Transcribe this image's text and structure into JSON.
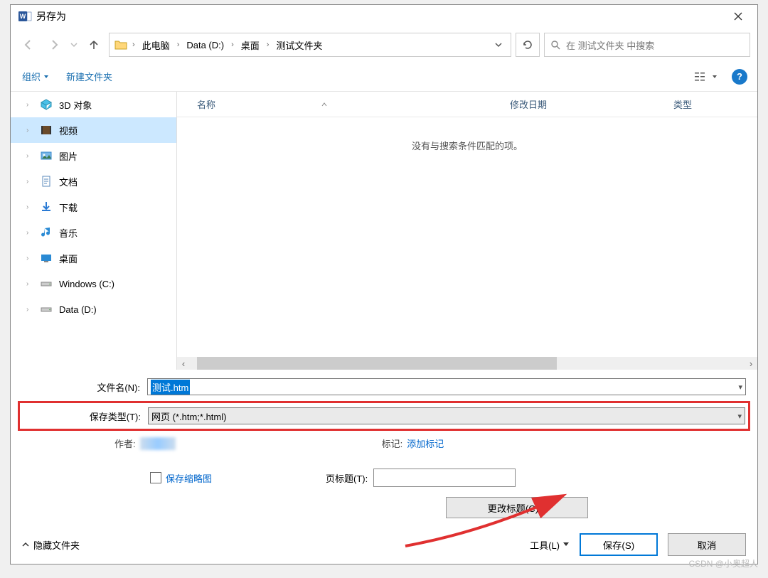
{
  "title": "另存为",
  "breadcrumb": [
    "此电脑",
    "Data (D:)",
    "桌面",
    "测试文件夹"
  ],
  "search_placeholder": "在 测试文件夹 中搜索",
  "toolbar": {
    "organize": "组织",
    "new_folder": "新建文件夹"
  },
  "sidebar_items": [
    {
      "label": "3D 对象",
      "icon": "cube",
      "color": "#2aa4d4"
    },
    {
      "label": "视频",
      "icon": "film",
      "color": "#8a5a2a",
      "selected": true
    },
    {
      "label": "图片",
      "icon": "image",
      "color": "#3a8acc"
    },
    {
      "label": "文档",
      "icon": "doc",
      "color": "#5a88bb"
    },
    {
      "label": "下载",
      "icon": "download",
      "color": "#2a7ad4"
    },
    {
      "label": "音乐",
      "icon": "music",
      "color": "#2a8ad4"
    },
    {
      "label": "桌面",
      "icon": "desktop",
      "color": "#2a8ad4"
    },
    {
      "label": "Windows (C:)",
      "icon": "drive",
      "color": "#888"
    },
    {
      "label": "Data (D:)",
      "icon": "drive",
      "color": "#888"
    }
  ],
  "columns": {
    "name": "名称",
    "date": "修改日期",
    "type": "类型"
  },
  "empty_message": "没有与搜索条件匹配的项。",
  "filename_label": "文件名(N):",
  "filename_value": "测试.htm",
  "filetype_label": "保存类型(T):",
  "filetype_value": "网页 (*.htm;*.html)",
  "author_label": "作者:",
  "tags_label": "标记:",
  "tags_link": "添加标记",
  "thumb_label": "保存缩略图",
  "pagetitle_label": "页标题(T):",
  "change_title_btn": "更改标题(C)...",
  "hide_folders": "隐藏文件夹",
  "tools": "工具(L)",
  "save": "保存(S)",
  "cancel": "取消",
  "watermark": "CSDN @小奥超人"
}
